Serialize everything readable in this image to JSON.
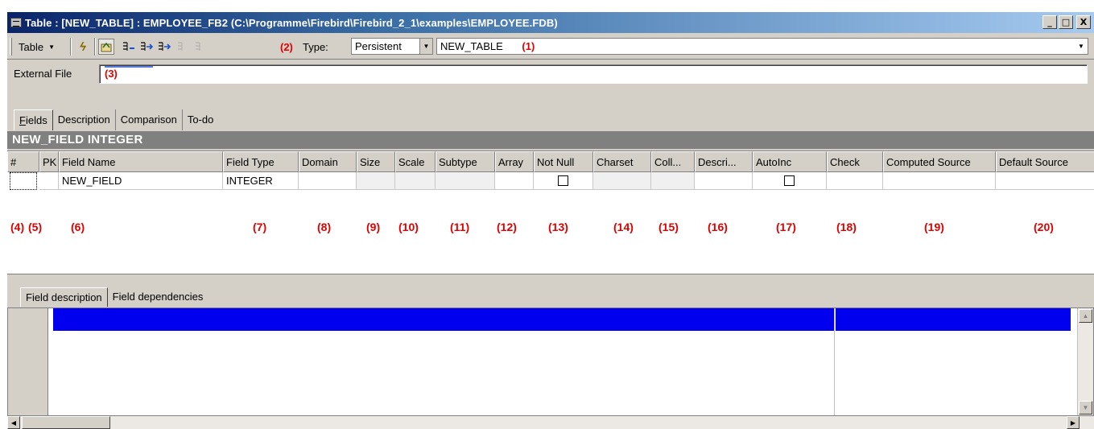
{
  "window": {
    "title": "Table : [NEW_TABLE] : EMPLOYEE_FB2 (C:\\Programme\\Firebird\\Firebird_2_1\\examples\\EMPLOYEE.FDB)",
    "minimize": "_",
    "maximize": "□",
    "close": "X"
  },
  "toolbar": {
    "table_menu": "Table",
    "marker_2": "(2)",
    "type_label": "Type:",
    "type_value": "Persistent",
    "table_name": "NEW_TABLE",
    "marker_1": "(1)"
  },
  "external_file": {
    "label": "External File",
    "marker_3": "(3)"
  },
  "tabs": [
    "Fields",
    "Description",
    "Comparison",
    "To-do"
  ],
  "field_header": "NEW_FIELD INTEGER",
  "grid": {
    "columns": [
      "#",
      "PK",
      "Field Name",
      "Field Type",
      "Domain",
      "Size",
      "Scale",
      "Subtype",
      "Array",
      "Not Null",
      "Charset",
      "Coll...",
      "Descri...",
      "AutoInc",
      "Check",
      "Computed Source",
      "Default Source"
    ],
    "row": {
      "field_name": "NEW_FIELD",
      "field_type": "INTEGER",
      "not_null": false,
      "autoinc": false
    },
    "markers": [
      "(4)",
      "(5)",
      "(6)",
      "(7)",
      "(8)",
      "(9)",
      "(10)",
      "(11)",
      "(12)",
      "(13)",
      "(14)",
      "(15)",
      "(16)",
      "(17)",
      "(18)",
      "(19)",
      "(20)"
    ]
  },
  "bottom_tabs": [
    "Field description",
    "Field dependencies"
  ],
  "colors": {
    "title_gradient_start": "#0a246a",
    "header_bar": "#808080",
    "selection_blue": "#0000ee",
    "marker_red": "#e00000"
  }
}
